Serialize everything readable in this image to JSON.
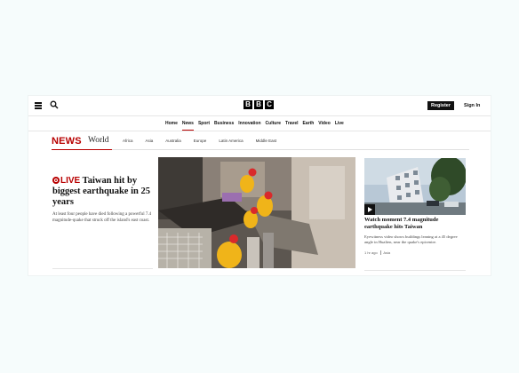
{
  "header": {
    "logo_letters": [
      "B",
      "B",
      "C"
    ],
    "register_label": "Register",
    "signin_label": "Sign In"
  },
  "nav": {
    "items": [
      {
        "label": "Home",
        "active": false
      },
      {
        "label": "News",
        "active": true
      },
      {
        "label": "Sport",
        "active": false
      },
      {
        "label": "Business",
        "active": false
      },
      {
        "label": "Innovation",
        "active": false
      },
      {
        "label": "Culture",
        "active": false
      },
      {
        "label": "Travel",
        "active": false
      },
      {
        "label": "Earth",
        "active": false
      },
      {
        "label": "Video",
        "active": false
      },
      {
        "label": "Live",
        "active": false
      }
    ]
  },
  "section": {
    "news_label": "NEWS",
    "world_label": "World",
    "regions": [
      "Africa",
      "Asia",
      "Australia",
      "Europe",
      "Latin America",
      "Middle East"
    ]
  },
  "lead_story": {
    "live_label": "LIVE",
    "headline": "Taiwan hit by biggest earthquake in 25 years",
    "summary": "At least four people have died following a powerful 7.4 magnitude-quake that struck off the island's east coast."
  },
  "side_story": {
    "headline": "Watch moment 7.4 magnitude earthquake hits Taiwan",
    "summary": "Eyewitness video shows buildings leaning at a 45 degree angle in Hualien, near the quake's epicentre.",
    "time": "1 hr ago",
    "region": "Asia"
  },
  "colors": {
    "brand_red": "#b80000",
    "background": "#f6fcfc"
  }
}
